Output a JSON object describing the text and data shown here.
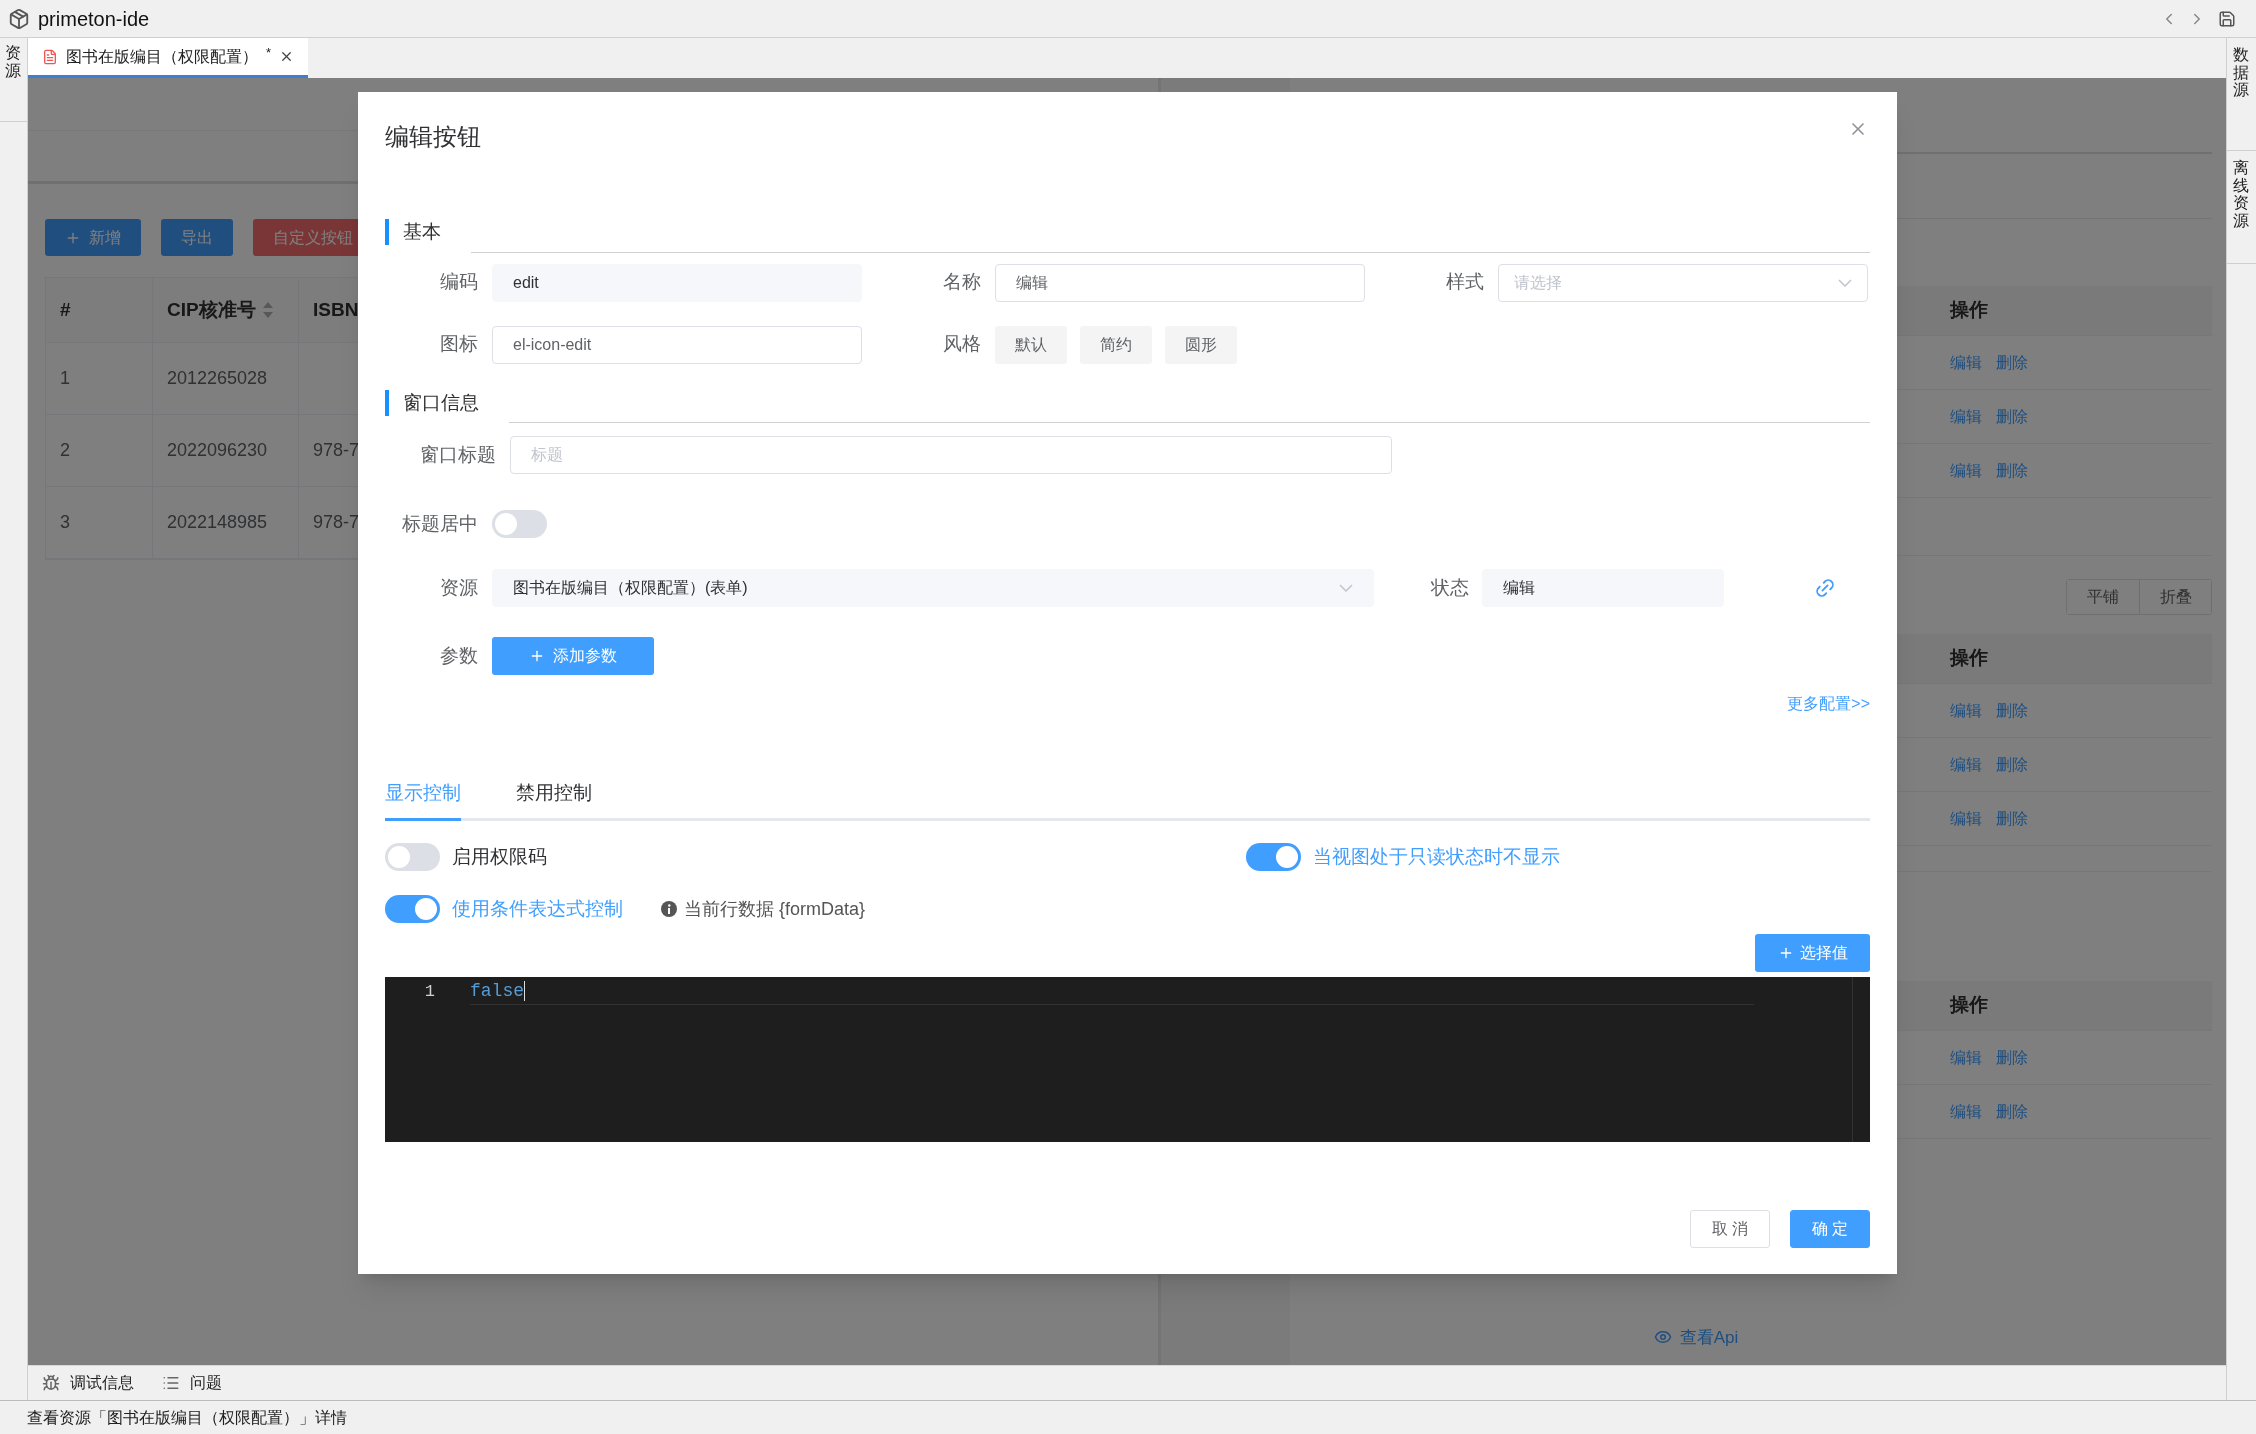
{
  "app": {
    "title": "primeton-ide"
  },
  "left_dock": [
    {
      "label": "资源"
    }
  ],
  "right_dock": [
    {
      "label": "数据源"
    },
    {
      "label": "离线资源"
    }
  ],
  "editor_tabs": [
    {
      "label": "图书在版编目（权限配置）",
      "marker": "*",
      "selected": true
    }
  ],
  "background": {
    "toolbar_buttons": [
      {
        "label": "新增",
        "kind": "add"
      },
      {
        "label": "导出",
        "kind": "primary"
      },
      {
        "label": "自定义按钮",
        "kind": "danger"
      }
    ],
    "table": {
      "columns": [
        {
          "label": "#",
          "sortable": false
        },
        {
          "label": "CIP核准号",
          "sortable": true
        },
        {
          "label": "ISBN"
        }
      ],
      "rows": [
        [
          "1",
          "2012265028"
        ],
        [
          "2",
          "2022096230",
          "978-7"
        ],
        [
          "3",
          "2022148985",
          "978-7"
        ]
      ]
    },
    "right_panel": {
      "groups": [
        {
          "header": "操作",
          "rows": [
            [
              "编辑",
              "删除"
            ],
            [
              "编辑",
              "删除"
            ],
            [
              "编辑",
              "删除"
            ]
          ]
        },
        {
          "view_buttons": [
            "平铺",
            "折叠"
          ],
          "header": "操作",
          "rows": [
            [
              "编辑",
              "删除"
            ],
            [
              "编辑",
              "删除"
            ],
            [
              "编辑",
              "删除"
            ]
          ]
        },
        {
          "header": "操作",
          "rows": [
            [
              "编辑",
              "删除"
            ],
            [
              "编辑",
              "删除"
            ]
          ]
        }
      ],
      "api_link": "查看Api"
    }
  },
  "dialog": {
    "title": "编辑按钮",
    "basic": {
      "title": "基本",
      "code": {
        "label": "编码",
        "value": "edit",
        "disabled": true
      },
      "name": {
        "label": "名称",
        "value": "编辑",
        "disabled": false
      },
      "style": {
        "label": "样式",
        "placeholder": "请选择"
      },
      "icon": {
        "label": "图标",
        "value": "el-icon-edit",
        "disabled": false
      },
      "variant": {
        "label": "风格",
        "options": [
          "默认",
          "简约",
          "圆形"
        ]
      }
    },
    "window": {
      "title": "窗口信息",
      "window_title": {
        "label": "窗口标题",
        "placeholder": "标题"
      },
      "center_title": {
        "label": "标题居中",
        "on": false
      },
      "resource": {
        "label": "资源",
        "value": "图书在版编目（权限配置）(表单)",
        "disabled": true
      },
      "status": {
        "label": "状态",
        "value": "编辑",
        "disabled": true
      },
      "params": {
        "label": "参数",
        "button": "添加参数"
      },
      "more_link": "更多配置>>"
    },
    "tabs": [
      {
        "label": "显示控制",
        "selected": true
      },
      {
        "label": "禁用控制",
        "selected": false
      }
    ],
    "switches": [
      {
        "label": "启用权限码",
        "on": false
      },
      {
        "label": "当视图处于只读状态时不显示",
        "on": true
      },
      {
        "label": "使用条件表达式控制",
        "on": true
      }
    ],
    "hint": "当前行数据 {formData}",
    "select_value_button": "选择值",
    "editor": {
      "lines": [
        {
          "number": "1",
          "code": "false"
        }
      ]
    },
    "buttons": [
      {
        "label": "取 消",
        "kind": "secondary"
      },
      {
        "label": "确 定",
        "kind": "primary"
      }
    ]
  },
  "bottom_panel": {
    "tabs": [
      {
        "label": "调试信息",
        "kind": "debug"
      },
      {
        "label": "问题",
        "kind": "problems"
      }
    ]
  },
  "status_bar": {
    "text": "查看资源「图书在版编目（权限配置）」详情"
  }
}
